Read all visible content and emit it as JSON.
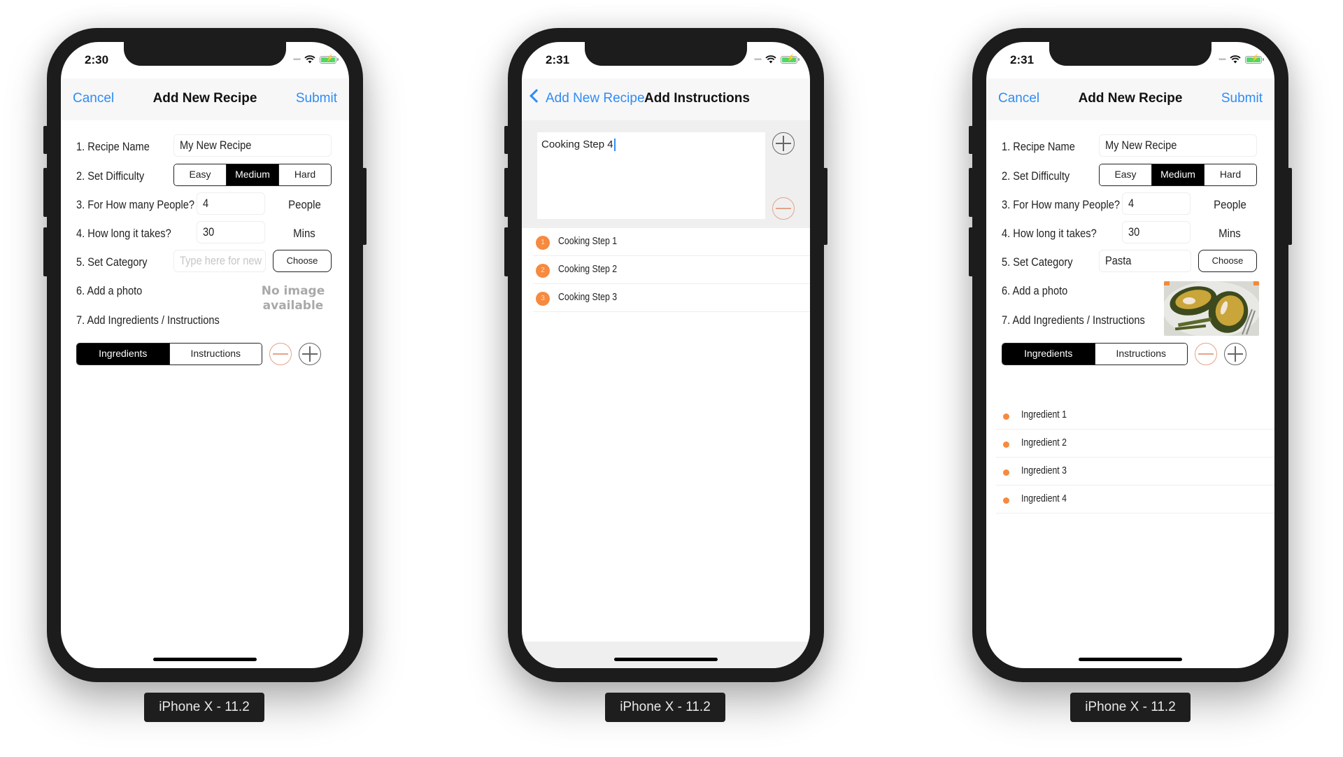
{
  "devices": [
    {
      "label": "iPhone X - 11.2",
      "status": {
        "time": "2:30",
        "signal_icon": "signal-dots-icon",
        "wifi_icon": "wifi-icon",
        "battery_icon": "battery-charging-icon"
      },
      "nav": {
        "left": "Cancel",
        "title": "Add New Recipe",
        "right": "Submit"
      },
      "form": {
        "recipe_name_label": "1. Recipe Name",
        "recipe_name_value": "My New Recipe",
        "difficulty_label": "2. Set Difficulty",
        "difficulty_options": [
          "Easy",
          "Medium",
          "Hard"
        ],
        "difficulty_selected": "Medium",
        "people_label": "3. For How many People?",
        "people_value": "4",
        "people_unit": "People",
        "time_label": "4. How long it takes?",
        "time_value": "30",
        "time_unit": "Mins",
        "category_label": "5. Set Category",
        "category_placeholder": "Type here for new",
        "category_value": "",
        "choose_button": "Choose",
        "photo_label": "6. Add a photo",
        "photo_placeholder_line1": "No image",
        "photo_placeholder_line2": "available",
        "ingredients_label": "7. Add Ingredients / Instructions",
        "tabs": [
          "Ingredients",
          "Instructions"
        ],
        "tab_selected": "Ingredients"
      },
      "list": []
    },
    {
      "label": "iPhone X - 11.2",
      "status": {
        "time": "2:31",
        "signal_icon": "signal-dots-icon",
        "wifi_icon": "wifi-icon",
        "battery_icon": "battery-charging-icon"
      },
      "nav": {
        "back": "Add New Recipe",
        "title": "Add Instructions"
      },
      "instruction_input": "Cooking Step 4",
      "steps": [
        {
          "num": "1",
          "text": "Cooking Step 1"
        },
        {
          "num": "2",
          "text": "Cooking Step 2"
        },
        {
          "num": "3",
          "text": "Cooking Step 3"
        }
      ]
    },
    {
      "label": "iPhone X - 11.2",
      "status": {
        "time": "2:31",
        "signal_icon": "signal-dots-icon",
        "wifi_icon": "wifi-icon",
        "battery_icon": "battery-charging-icon"
      },
      "nav": {
        "left": "Cancel",
        "title": "Add New Recipe",
        "right": "Submit"
      },
      "form": {
        "recipe_name_label": "1. Recipe Name",
        "recipe_name_value": "My New Recipe",
        "difficulty_label": "2. Set Difficulty",
        "difficulty_options": [
          "Easy",
          "Medium",
          "Hard"
        ],
        "difficulty_selected": "Medium",
        "people_label": "3. For How many People?",
        "people_value": "4",
        "people_unit": "People",
        "time_label": "4. How long it takes?",
        "time_value": "30",
        "time_unit": "Mins",
        "category_label": "5. Set Category",
        "category_value": "Pasta",
        "choose_button": "Choose",
        "photo_label": "6. Add a photo",
        "photo_description": "Baked avocado with egg and asparagus",
        "ingredients_label": "7. Add Ingredients / Instructions",
        "tabs": [
          "Ingredients",
          "Instructions"
        ],
        "tab_selected": "Ingredients"
      },
      "list": [
        "Ingredient 1",
        "Ingredient 2",
        "Ingredient 3",
        "Ingredient 4"
      ]
    }
  ],
  "colors": {
    "accent": "#2f8cf4",
    "bullet": "#f68a3f",
    "minus": "#e2a48a",
    "frame": "#1c1c1c"
  }
}
